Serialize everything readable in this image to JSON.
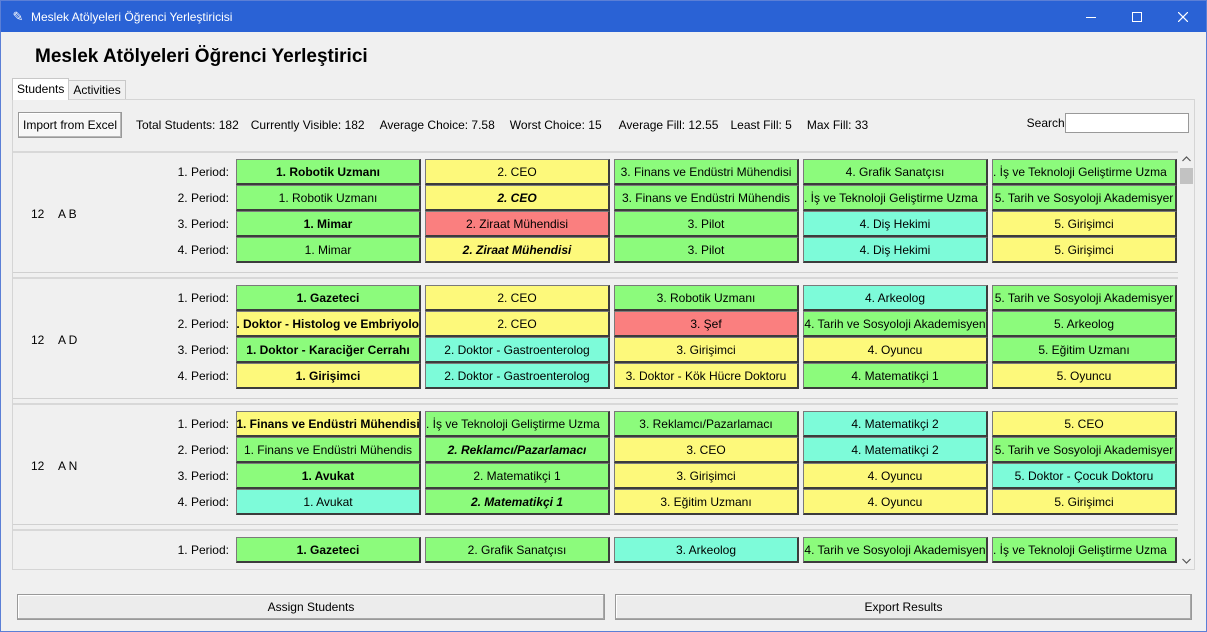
{
  "window": {
    "title": "Meslek Atölyeleri Öğrenci Yerleştiricisi"
  },
  "app_title": "Meslek Atölyeleri Öğrenci Yerleştirici",
  "tabs": [
    {
      "label": "Students"
    },
    {
      "label": "Activities"
    }
  ],
  "toolbar": {
    "import_label": "Import from Excel",
    "stats": [
      "Total Students: 182",
      "Currently Visible: 182",
      "Average Choice: 7.58",
      "Worst Choice: 15",
      "Average Fill: 12.55",
      "Least Fill: 5",
      "Max Fill: 33"
    ],
    "search_label": "Search:",
    "search_value": ""
  },
  "colors": {
    "green": "#8cfb7c",
    "yellow": "#fdf97b",
    "cyan": "#7dfbd9",
    "red": "#fa7f7f",
    "titlebar": "#2a62d5"
  },
  "students": [
    {
      "grade": "12",
      "name": "A B",
      "periods": [
        {
          "label": "1. Period:",
          "cells": [
            {
              "text": "1. Robotik Uzmanı",
              "color": "green",
              "style": "b"
            },
            {
              "text": "2. CEO",
              "color": "yellow",
              "style": ""
            },
            {
              "text": "3. Finans ve Endüstri Mühendisi",
              "color": "green",
              "style": ""
            },
            {
              "text": "4. Grafik Sanatçısı",
              "color": "green",
              "style": ""
            },
            {
              "text": ". İş ve Teknoloji Geliştirme Uzma",
              "color": "green",
              "style": ""
            }
          ]
        },
        {
          "label": "2. Period:",
          "cells": [
            {
              "text": "1. Robotik Uzmanı",
              "color": "green",
              "style": ""
            },
            {
              "text": "2. CEO",
              "color": "yellow",
              "style": "bi"
            },
            {
              "text": "3. Finans ve Endüstri Mühendis",
              "color": "green",
              "style": ""
            },
            {
              "text": ". İş ve Teknoloji Geliştirme Uzma",
              "color": "green",
              "style": ""
            },
            {
              "text": "5. Tarih ve Sosyoloji Akademisyer",
              "color": "green",
              "style": ""
            }
          ]
        },
        {
          "label": "3. Period:",
          "cells": [
            {
              "text": "1. Mimar",
              "color": "green",
              "style": "b"
            },
            {
              "text": "2. Ziraat Mühendisi",
              "color": "red",
              "style": ""
            },
            {
              "text": "3. Pilot",
              "color": "green",
              "style": ""
            },
            {
              "text": "4. Diş Hekimi",
              "color": "cyan",
              "style": ""
            },
            {
              "text": "5. Girişimci",
              "color": "yellow",
              "style": ""
            }
          ]
        },
        {
          "label": "4. Period:",
          "cells": [
            {
              "text": "1. Mimar",
              "color": "green",
              "style": ""
            },
            {
              "text": "2. Ziraat Mühendisi",
              "color": "yellow",
              "style": "bi"
            },
            {
              "text": "3. Pilot",
              "color": "green",
              "style": ""
            },
            {
              "text": "4. Diş Hekimi",
              "color": "cyan",
              "style": ""
            },
            {
              "text": "5. Girişimci",
              "color": "yellow",
              "style": ""
            }
          ]
        }
      ]
    },
    {
      "grade": "12",
      "name": "A D",
      "periods": [
        {
          "label": "1. Period:",
          "cells": [
            {
              "text": "1. Gazeteci",
              "color": "green",
              "style": "b"
            },
            {
              "text": "2. CEO",
              "color": "yellow",
              "style": ""
            },
            {
              "text": "3. Robotik Uzmanı",
              "color": "green",
              "style": ""
            },
            {
              "text": "4. Arkeolog",
              "color": "cyan",
              "style": ""
            },
            {
              "text": "5. Tarih ve Sosyoloji Akademisyer",
              "color": "green",
              "style": ""
            }
          ]
        },
        {
          "label": "2. Period:",
          "cells": [
            {
              "text": "1. Doktor - Histolog ve Embriyolog",
              "color": "yellow",
              "style": "b"
            },
            {
              "text": "2. CEO",
              "color": "yellow",
              "style": ""
            },
            {
              "text": "3. Şef",
              "color": "red",
              "style": ""
            },
            {
              "text": "4. Tarih ve Sosyoloji Akademisyen",
              "color": "green",
              "style": ""
            },
            {
              "text": "5. Arkeolog",
              "color": "green",
              "style": ""
            }
          ]
        },
        {
          "label": "3. Period:",
          "cells": [
            {
              "text": "1. Doktor - Karaciğer Cerrahı",
              "color": "green",
              "style": "b"
            },
            {
              "text": "2. Doktor - Gastroenterolog",
              "color": "cyan",
              "style": ""
            },
            {
              "text": "3. Girişimci",
              "color": "yellow",
              "style": ""
            },
            {
              "text": "4. Oyuncu",
              "color": "yellow",
              "style": ""
            },
            {
              "text": "5. Eğitim Uzmanı",
              "color": "green",
              "style": ""
            }
          ]
        },
        {
          "label": "4. Period:",
          "cells": [
            {
              "text": "1. Girişimci",
              "color": "yellow",
              "style": "b"
            },
            {
              "text": "2. Doktor - Gastroenterolog",
              "color": "cyan",
              "style": ""
            },
            {
              "text": "3. Doktor - Kök Hücre Doktoru",
              "color": "yellow",
              "style": ""
            },
            {
              "text": "4. Matematikçi 1",
              "color": "green",
              "style": ""
            },
            {
              "text": "5. Oyuncu",
              "color": "yellow",
              "style": ""
            }
          ]
        }
      ]
    },
    {
      "grade": "12",
      "name": "A N",
      "periods": [
        {
          "label": "1. Period:",
          "cells": [
            {
              "text": "1. Finans ve Endüstri Mühendisi",
              "color": "yellow",
              "style": "b"
            },
            {
              "text": ". İş ve Teknoloji Geliştirme Uzma",
              "color": "green",
              "style": ""
            },
            {
              "text": "3. Reklamcı/Pazarlamacı",
              "color": "green",
              "style": ""
            },
            {
              "text": "4. Matematikçi 2",
              "color": "cyan",
              "style": ""
            },
            {
              "text": "5. CEO",
              "color": "yellow",
              "style": ""
            }
          ]
        },
        {
          "label": "2. Period:",
          "cells": [
            {
              "text": "1. Finans ve Endüstri Mühendis",
              "color": "green",
              "style": ""
            },
            {
              "text": "2. Reklamcı/Pazarlamacı",
              "color": "green",
              "style": "bi"
            },
            {
              "text": "3. CEO",
              "color": "yellow",
              "style": ""
            },
            {
              "text": "4. Matematikçi 2",
              "color": "cyan",
              "style": ""
            },
            {
              "text": "5. Tarih ve Sosyoloji Akademisyer",
              "color": "green",
              "style": ""
            }
          ]
        },
        {
          "label": "3. Period:",
          "cells": [
            {
              "text": "1. Avukat",
              "color": "green",
              "style": "b"
            },
            {
              "text": "2. Matematikçi 1",
              "color": "green",
              "style": ""
            },
            {
              "text": "3. Girişimci",
              "color": "yellow",
              "style": ""
            },
            {
              "text": "4. Oyuncu",
              "color": "yellow",
              "style": ""
            },
            {
              "text": "5. Doktor - Çocuk Doktoru",
              "color": "cyan",
              "style": ""
            }
          ]
        },
        {
          "label": "4. Period:",
          "cells": [
            {
              "text": "1. Avukat",
              "color": "cyan",
              "style": ""
            },
            {
              "text": "2. Matematikçi 1",
              "color": "green",
              "style": "bi"
            },
            {
              "text": "3. Eğitim Uzmanı",
              "color": "yellow",
              "style": ""
            },
            {
              "text": "4. Oyuncu",
              "color": "yellow",
              "style": ""
            },
            {
              "text": "5. Girişimci",
              "color": "yellow",
              "style": ""
            }
          ]
        }
      ]
    },
    {
      "grade": "",
      "name": "",
      "periods": [
        {
          "label": "1. Period:",
          "cells": [
            {
              "text": "1. Gazeteci",
              "color": "green",
              "style": "b"
            },
            {
              "text": "2. Grafik Sanatçısı",
              "color": "green",
              "style": ""
            },
            {
              "text": "3. Arkeolog",
              "color": "cyan",
              "style": ""
            },
            {
              "text": "4. Tarih ve Sosyoloji Akademisyen",
              "color": "green",
              "style": ""
            },
            {
              "text": ". İş ve Teknoloji Geliştirme Uzma",
              "color": "green",
              "style": ""
            }
          ]
        }
      ]
    }
  ],
  "bottom": {
    "assign_label": "Assign Students",
    "export_label": "Export Results"
  }
}
